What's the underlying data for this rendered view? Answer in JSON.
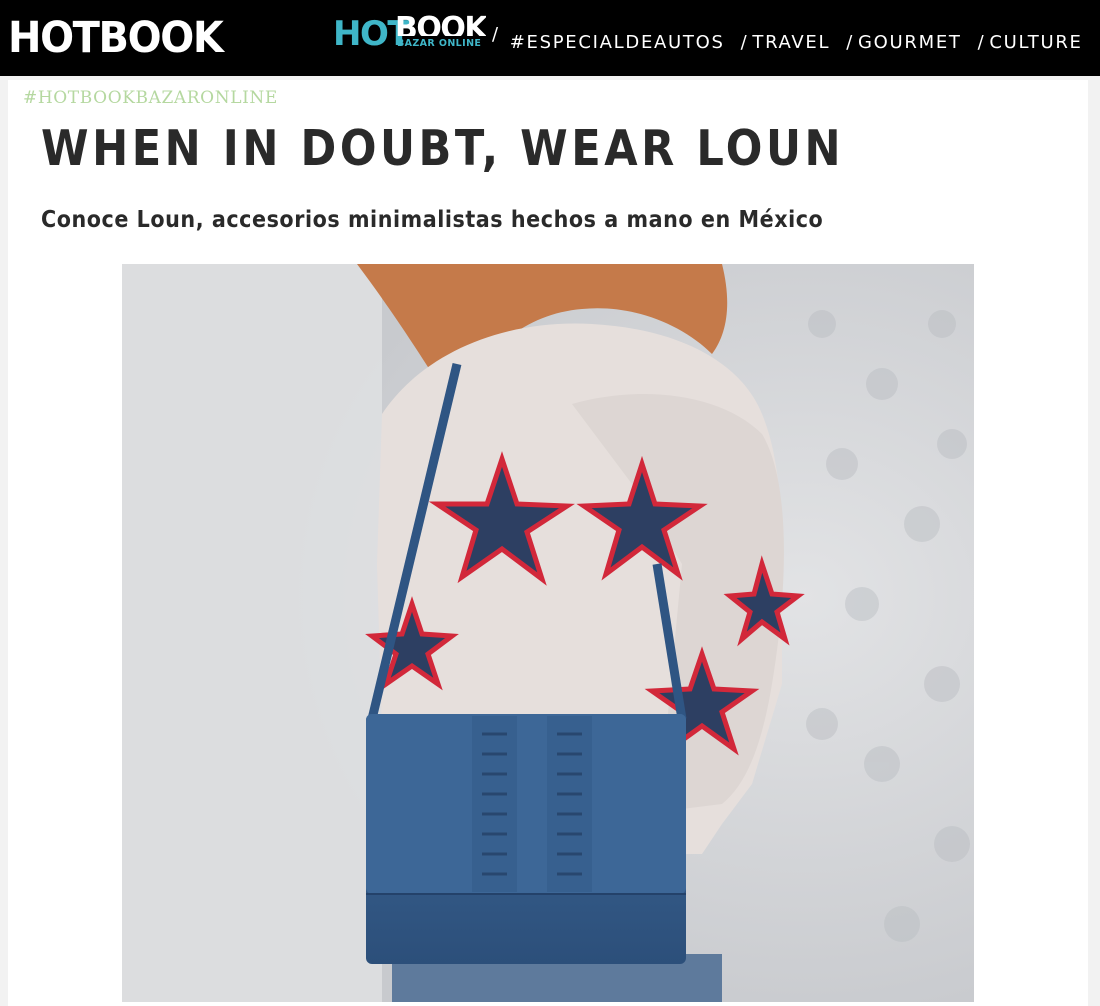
{
  "header": {
    "logo_text": "HOTBOOK",
    "bazar_logo": {
      "hot": "HOT",
      "book": "BOOK",
      "sub": "BAZAR ONLINE"
    },
    "separator": "/",
    "nav": [
      {
        "slash": "",
        "label": "#ESPECIALDEAUTOS"
      },
      {
        "slash": "/",
        "label": "TRAVEL"
      },
      {
        "slash": "/",
        "label": "GOURMET"
      },
      {
        "slash": "/",
        "label": "CULTURE"
      }
    ],
    "colors": {
      "bar": "#000000",
      "accent": "#3fb6c8"
    }
  },
  "article": {
    "tag": "#HOTBOOKBAZARONLINE",
    "title": "WHEN IN DOUBT, WEAR LOUN",
    "subtitle": "Conoce Loun, accesorios minimalistas hechos a mano en México",
    "tag_color": "#b5d8a0"
  }
}
